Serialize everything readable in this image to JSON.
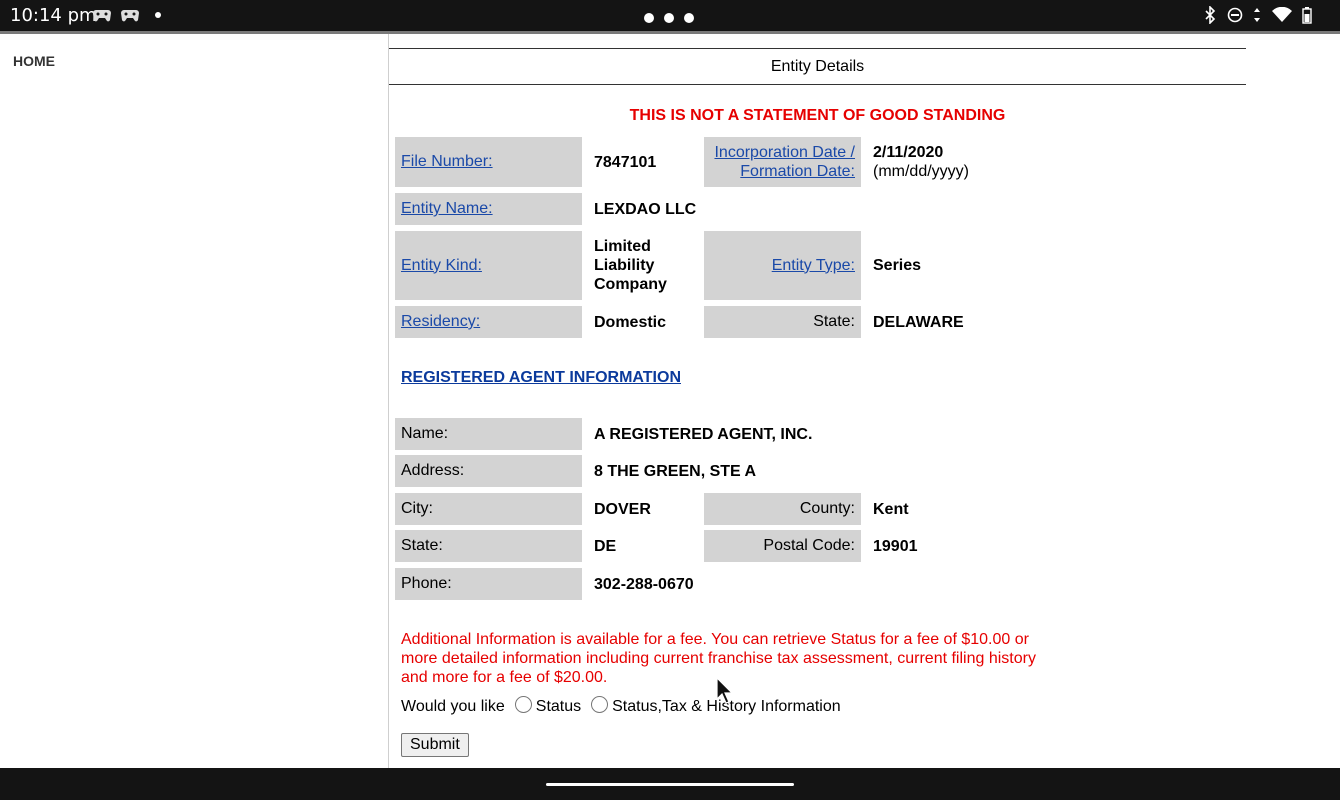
{
  "statusbar": {
    "time": "10:14 pm"
  },
  "nav": {
    "home": "HOME"
  },
  "header": {
    "title": "Entity Details",
    "warning": "THIS IS NOT A STATEMENT OF GOOD STANDING"
  },
  "entity": {
    "file_number_label": "File Number:",
    "file_number": "7847101",
    "inc_date_label_1": "Incorporation Date /",
    "inc_date_label_2": "Formation Date:",
    "inc_date": "2/11/2020",
    "inc_date_format": "(mm/dd/yyyy)",
    "name_label": "Entity Name:",
    "name": "LEXDAO LLC",
    "kind_label": "Entity Kind:",
    "kind_1": "Limited",
    "kind_2": "Liability",
    "kind_3": "Company",
    "type_label": "Entity Type:",
    "type": "Series",
    "residency_label": "Residency:",
    "residency": "Domestic",
    "state_label": "State:",
    "state": "DELAWARE"
  },
  "agent": {
    "section_title": "REGISTERED AGENT INFORMATION",
    "name_label": "Name:",
    "name": "A REGISTERED AGENT, INC.",
    "address_label": "Address:",
    "address": "8 THE GREEN, STE A",
    "city_label": "City:",
    "city": "DOVER",
    "county_label": "County:",
    "county": "Kent",
    "state_label": "State:",
    "state": "DE",
    "postal_label": "Postal Code:",
    "postal": "19901",
    "phone_label": "Phone:",
    "phone": "302-288-0670"
  },
  "fee": {
    "note": "Additional Information is available for a fee. You can retrieve Status for a fee of $10.00 or more detailed information including current franchise tax assessment, current filing history and more for a fee of $20.00.",
    "prompt": "Would you like",
    "option_status": "Status",
    "option_full": "Status,Tax & History Information",
    "submit": "Submit"
  }
}
